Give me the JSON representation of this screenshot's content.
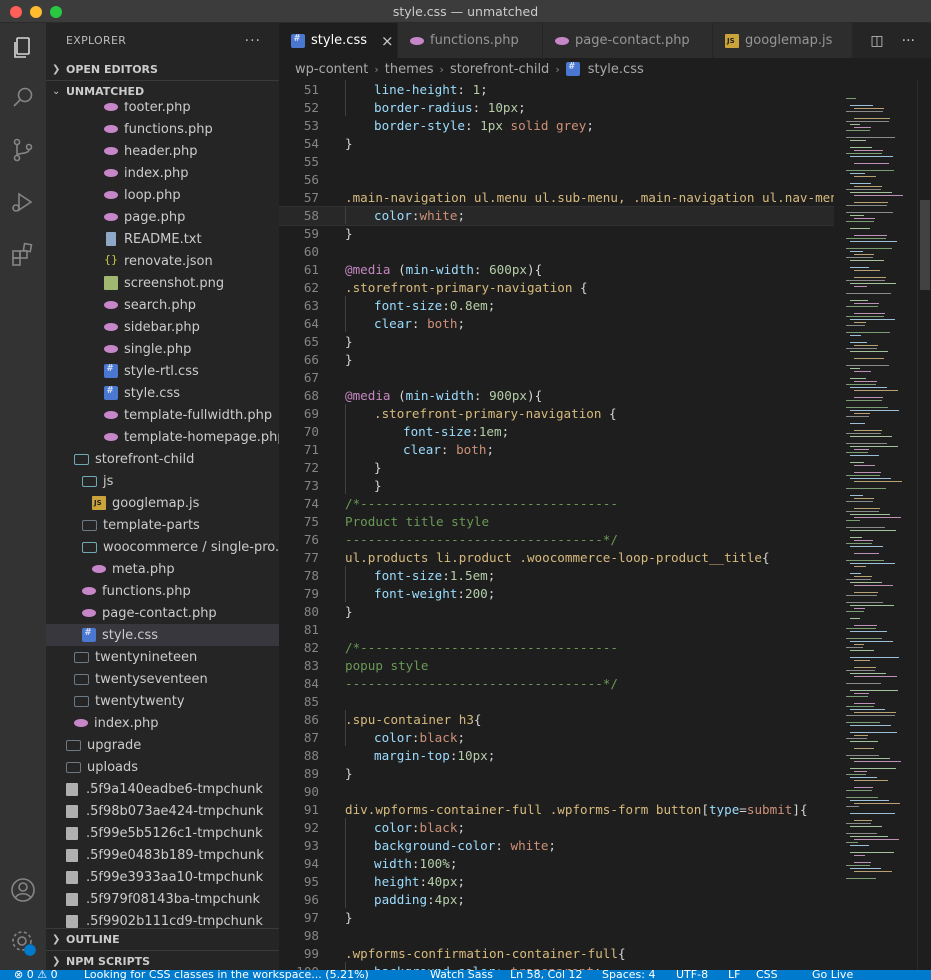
{
  "window": {
    "title": "style.css — unmatched"
  },
  "explorer": {
    "title": "EXPLORER",
    "more": "···",
    "open_editors": "OPEN EDITORS",
    "workspace": "UNMATCHED",
    "outline": "OUTLINE",
    "npm": "NPM SCRIPTS",
    "items": [
      {
        "label": "footer.php",
        "icon": "php",
        "indent": 58
      },
      {
        "label": "functions.php",
        "icon": "php",
        "indent": 58
      },
      {
        "label": "header.php",
        "icon": "php",
        "indent": 58
      },
      {
        "label": "index.php",
        "icon": "php",
        "indent": 58
      },
      {
        "label": "loop.php",
        "icon": "php",
        "indent": 58
      },
      {
        "label": "page.php",
        "icon": "php",
        "indent": 58
      },
      {
        "label": "README.txt",
        "icon": "txt",
        "indent": 58
      },
      {
        "label": "renovate.json",
        "icon": "json",
        "indent": 58
      },
      {
        "label": "screenshot.png",
        "icon": "png",
        "indent": 58
      },
      {
        "label": "search.php",
        "icon": "php",
        "indent": 58
      },
      {
        "label": "sidebar.php",
        "icon": "php",
        "indent": 58
      },
      {
        "label": "single.php",
        "icon": "php",
        "indent": 58
      },
      {
        "label": "style-rtl.css",
        "icon": "css",
        "indent": 58
      },
      {
        "label": "style.css",
        "icon": "css",
        "indent": 58
      },
      {
        "label": "template-fullwidth.php",
        "icon": "php",
        "indent": 58
      },
      {
        "label": "template-homepage.php",
        "icon": "php",
        "indent": 58
      },
      {
        "label": "storefront-child",
        "icon": "folder-open",
        "indent": 28
      },
      {
        "label": "js",
        "icon": "folder-open",
        "indent": 36
      },
      {
        "label": "googlemap.js",
        "icon": "js",
        "indent": 46
      },
      {
        "label": "template-parts",
        "icon": "folder",
        "indent": 36
      },
      {
        "label": "woocommerce / single-pro...",
        "icon": "folder-open",
        "indent": 36
      },
      {
        "label": "meta.php",
        "icon": "php",
        "indent": 46
      },
      {
        "label": "functions.php",
        "icon": "php",
        "indent": 36
      },
      {
        "label": "page-contact.php",
        "icon": "php",
        "indent": 36
      },
      {
        "label": "style.css",
        "icon": "css",
        "indent": 36,
        "selected": true
      },
      {
        "label": "twentynineteen",
        "icon": "folder",
        "indent": 28
      },
      {
        "label": "twentyseventeen",
        "icon": "folder",
        "indent": 28
      },
      {
        "label": "twentytwenty",
        "icon": "folder",
        "indent": 28
      },
      {
        "label": "index.php",
        "icon": "php",
        "indent": 28
      },
      {
        "label": "upgrade",
        "icon": "folder",
        "indent": 20
      },
      {
        "label": "uploads",
        "icon": "folder",
        "indent": 20
      },
      {
        "label": ".5f9a140eadbe6-tmpchunk",
        "icon": "chunk",
        "indent": 20
      },
      {
        "label": ".5f98b073ae424-tmpchunk",
        "icon": "chunk",
        "indent": 20
      },
      {
        "label": ".5f99e5b5126c1-tmpchunk",
        "icon": "chunk",
        "indent": 20
      },
      {
        "label": ".5f99e0483b189-tmpchunk",
        "icon": "chunk",
        "indent": 20
      },
      {
        "label": ".5f99e3933aa10-tmpchunk",
        "icon": "chunk",
        "indent": 20
      },
      {
        "label": ".5f979f08143ba-tmpchunk",
        "icon": "chunk",
        "indent": 20
      },
      {
        "label": ".5f9902b111cd9-tmpchunk",
        "icon": "chunk",
        "indent": 20
      }
    ]
  },
  "tabs": [
    {
      "label": "style.css",
      "icon": "css",
      "active": true,
      "close": "×"
    },
    {
      "label": "functions.php",
      "icon": "php"
    },
    {
      "label": "page-contact.php",
      "icon": "php"
    },
    {
      "label": "googlemap.js",
      "icon": "js"
    }
  ],
  "breadcrumb": [
    "wp-content",
    "themes",
    "storefront-child",
    "style.css"
  ],
  "editor": {
    "cursor_line": 58,
    "lines": [
      {
        "n": "51",
        "ind": 1,
        "t": [
          [
            "line-height",
            "prop"
          ],
          [
            ": ",
            "pun"
          ],
          [
            "1",
            "num"
          ],
          [
            ";",
            "pun"
          ]
        ]
      },
      {
        "n": "52",
        "ind": 1,
        "t": [
          [
            "border-radius",
            "prop"
          ],
          [
            ": ",
            "pun"
          ],
          [
            "10px",
            "num"
          ],
          [
            ";",
            "pun"
          ]
        ]
      },
      {
        "n": "53",
        "ind": 1,
        "t": [
          [
            "border-style",
            "prop"
          ],
          [
            ": ",
            "pun"
          ],
          [
            "1px",
            "num"
          ],
          [
            " solid grey",
            "val"
          ],
          [
            ";",
            "pun"
          ]
        ]
      },
      {
        "n": "54",
        "ind": 0,
        "t": [
          [
            "}",
            "pun"
          ]
        ]
      },
      {
        "n": "55",
        "ind": 0,
        "t": []
      },
      {
        "n": "56",
        "ind": 0,
        "t": []
      },
      {
        "n": "57",
        "ind": 0,
        "t": [
          [
            ".main-navigation ul.menu ul.sub-menu, .main-navigation ul.nav-menu ul",
            "sel"
          ]
        ]
      },
      {
        "n": "58",
        "ind": 1,
        "t": [
          [
            "color",
            "prop"
          ],
          [
            ":",
            "pun"
          ],
          [
            "white",
            "val"
          ],
          [
            ";",
            "pun"
          ]
        ]
      },
      {
        "n": "59",
        "ind": 0,
        "t": [
          [
            "}",
            "pun"
          ]
        ]
      },
      {
        "n": "60",
        "ind": 0,
        "t": []
      },
      {
        "n": "61",
        "ind": 0,
        "t": [
          [
            "@media",
            "at"
          ],
          [
            " (",
            "pun"
          ],
          [
            "min-width",
            "prop"
          ],
          [
            ": ",
            "pun"
          ],
          [
            "600px",
            "num"
          ],
          [
            "){",
            "pun"
          ]
        ]
      },
      {
        "n": "62",
        "ind": 0,
        "t": [
          [
            ".storefront-primary-navigation",
            "sel"
          ],
          [
            " {",
            "pun"
          ]
        ]
      },
      {
        "n": "63",
        "ind": 1,
        "t": [
          [
            "font-size",
            "prop"
          ],
          [
            ":",
            "pun"
          ],
          [
            "0.8em",
            "num"
          ],
          [
            ";",
            "pun"
          ]
        ]
      },
      {
        "n": "64",
        "ind": 1,
        "t": [
          [
            "clear",
            "prop"
          ],
          [
            ": ",
            "pun"
          ],
          [
            "both",
            "val"
          ],
          [
            ";",
            "pun"
          ]
        ]
      },
      {
        "n": "65",
        "ind": 0,
        "t": [
          [
            "}",
            "pun"
          ]
        ]
      },
      {
        "n": "66",
        "ind": 0,
        "t": [
          [
            "}",
            "pun"
          ]
        ]
      },
      {
        "n": "67",
        "ind": 0,
        "t": []
      },
      {
        "n": "68",
        "ind": 0,
        "t": [
          [
            "@media",
            "at"
          ],
          [
            " (",
            "pun"
          ],
          [
            "min-width",
            "prop"
          ],
          [
            ": ",
            "pun"
          ],
          [
            "900px",
            "num"
          ],
          [
            "){",
            "pun"
          ]
        ]
      },
      {
        "n": "69",
        "ind": 1,
        "t": [
          [
            ".storefront-primary-navigation",
            "sel"
          ],
          [
            " {",
            "pun"
          ]
        ]
      },
      {
        "n": "70",
        "ind": 2,
        "t": [
          [
            "font-size",
            "prop"
          ],
          [
            ":",
            "pun"
          ],
          [
            "1em",
            "num"
          ],
          [
            ";",
            "pun"
          ]
        ]
      },
      {
        "n": "71",
        "ind": 2,
        "t": [
          [
            "clear",
            "prop"
          ],
          [
            ": ",
            "pun"
          ],
          [
            "both",
            "val"
          ],
          [
            ";",
            "pun"
          ]
        ]
      },
      {
        "n": "72",
        "ind": 1,
        "t": [
          [
            "}",
            "pun"
          ]
        ]
      },
      {
        "n": "73",
        "ind": 1,
        "t": [
          [
            "}",
            "pun"
          ]
        ]
      },
      {
        "n": "74",
        "ind": 0,
        "t": [
          [
            "/*----------------------------------",
            "com"
          ]
        ]
      },
      {
        "n": "75",
        "ind": 0,
        "t": [
          [
            "Product title style",
            "com"
          ]
        ]
      },
      {
        "n": "76",
        "ind": 0,
        "t": [
          [
            "----------------------------------*/",
            "com"
          ]
        ]
      },
      {
        "n": "77",
        "ind": 0,
        "t": [
          [
            "ul.products li.product .woocommerce-loop-product__title",
            "sel"
          ],
          [
            "{",
            "pun"
          ]
        ]
      },
      {
        "n": "78",
        "ind": 1,
        "t": [
          [
            "font-size",
            "prop"
          ],
          [
            ":",
            "pun"
          ],
          [
            "1.5em",
            "num"
          ],
          [
            ";",
            "pun"
          ]
        ]
      },
      {
        "n": "79",
        "ind": 1,
        "t": [
          [
            "font-weight",
            "prop"
          ],
          [
            ":",
            "pun"
          ],
          [
            "200",
            "num"
          ],
          [
            ";",
            "pun"
          ]
        ]
      },
      {
        "n": "80",
        "ind": 0,
        "t": [
          [
            "}",
            "pun"
          ]
        ]
      },
      {
        "n": "81",
        "ind": 0,
        "t": []
      },
      {
        "n": "82",
        "ind": 0,
        "t": [
          [
            "/*----------------------------------",
            "com"
          ]
        ]
      },
      {
        "n": "83",
        "ind": 0,
        "t": [
          [
            "popup style",
            "com"
          ]
        ]
      },
      {
        "n": "84",
        "ind": 0,
        "t": [
          [
            "----------------------------------*/",
            "com"
          ]
        ]
      },
      {
        "n": "85",
        "ind": 0,
        "t": []
      },
      {
        "n": "86",
        "ind": 0,
        "t": [
          [
            ".spu-container h3",
            "sel"
          ],
          [
            "{",
            "pun"
          ]
        ]
      },
      {
        "n": "87",
        "ind": 1,
        "t": [
          [
            "color",
            "prop"
          ],
          [
            ":",
            "pun"
          ],
          [
            "black",
            "val"
          ],
          [
            ";",
            "pun"
          ]
        ]
      },
      {
        "n": "88",
        "ind": 1,
        "t": [
          [
            "margin-top",
            "prop"
          ],
          [
            ":",
            "pun"
          ],
          [
            "10px",
            "num"
          ],
          [
            ";",
            "pun"
          ]
        ]
      },
      {
        "n": "89",
        "ind": 0,
        "t": [
          [
            "}",
            "pun"
          ]
        ]
      },
      {
        "n": "90",
        "ind": 0,
        "t": []
      },
      {
        "n": "91",
        "ind": 0,
        "t": [
          [
            "div.wpforms-container-full .wpforms-form button",
            "sel"
          ],
          [
            "[",
            "pun"
          ],
          [
            "type",
            "prop"
          ],
          [
            "=",
            "pun"
          ],
          [
            "submit",
            "val"
          ],
          [
            "]{",
            "pun"
          ]
        ]
      },
      {
        "n": "92",
        "ind": 1,
        "t": [
          [
            "color",
            "prop"
          ],
          [
            ":",
            "pun"
          ],
          [
            "black",
            "val"
          ],
          [
            ";",
            "pun"
          ]
        ]
      },
      {
        "n": "93",
        "ind": 1,
        "t": [
          [
            "background-color",
            "prop"
          ],
          [
            ": ",
            "pun"
          ],
          [
            "white",
            "val"
          ],
          [
            ";",
            "pun"
          ]
        ]
      },
      {
        "n": "94",
        "ind": 1,
        "t": [
          [
            "width",
            "prop"
          ],
          [
            ":",
            "pun"
          ],
          [
            "100%",
            "num"
          ],
          [
            ";",
            "pun"
          ]
        ]
      },
      {
        "n": "95",
        "ind": 1,
        "t": [
          [
            "height",
            "prop"
          ],
          [
            ":",
            "pun"
          ],
          [
            "40px",
            "num"
          ],
          [
            ";",
            "pun"
          ]
        ]
      },
      {
        "n": "96",
        "ind": 1,
        "t": [
          [
            "padding",
            "prop"
          ],
          [
            ":",
            "pun"
          ],
          [
            "4px",
            "num"
          ],
          [
            ";",
            "pun"
          ]
        ]
      },
      {
        "n": "97",
        "ind": 0,
        "t": [
          [
            "}",
            "pun"
          ]
        ]
      },
      {
        "n": "98",
        "ind": 0,
        "t": []
      },
      {
        "n": "99",
        "ind": 0,
        "t": [
          [
            ".wpforms-confirmation-container-full",
            "sel"
          ],
          [
            "{",
            "pun"
          ]
        ]
      },
      {
        "n": "100",
        "ind": 1,
        "t": [
          [
            "background-color",
            "prop"
          ],
          [
            ": ",
            "pun"
          ],
          [
            "transparent",
            "val"
          ],
          [
            ";",
            "pun"
          ]
        ]
      }
    ]
  },
  "status": {
    "problems": "⊗ 0  ⚠ 0",
    "message": "Looking for CSS classes in the workspace... (5.21%)",
    "watch": "Watch Sass",
    "position": "Ln 58, Col 12",
    "spaces": "Spaces: 4",
    "encoding": "UTF-8",
    "eol": "LF",
    "language": "CSS",
    "golive": "Go Live"
  },
  "colors": {
    "accent": "#007acc",
    "selector": "#d7ba7d",
    "property": "#9cdcfe",
    "number": "#b5cea8",
    "string": "#ce9178",
    "comment": "#6a9955",
    "at_rule": "#c586c0"
  }
}
